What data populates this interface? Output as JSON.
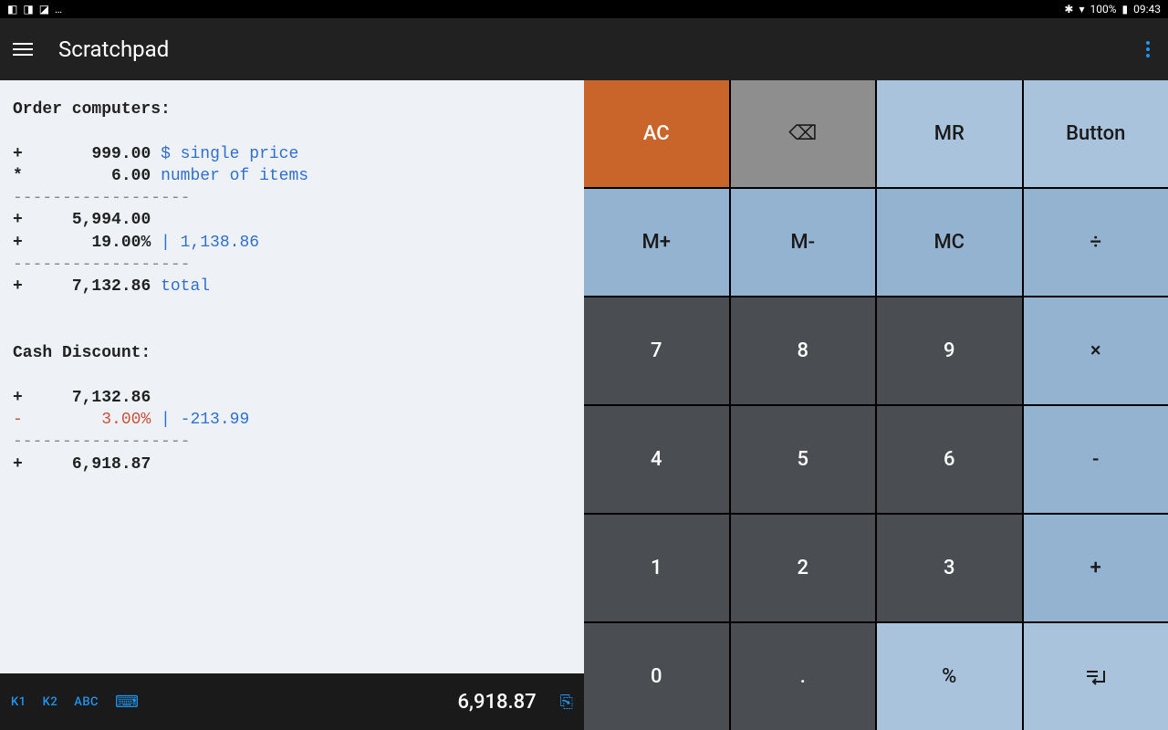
{
  "statusbar": {
    "battery": "100%",
    "time": "09:43"
  },
  "appbar": {
    "title": "Scratchpad"
  },
  "scratch": {
    "h1": "Order computers:",
    "l1_op": "+",
    "l1_val": "999.00",
    "l1_note": "$ single price",
    "l2_op": "*",
    "l2_val": "6.00",
    "l2_note": "number of items",
    "sep1": "------------------",
    "l3_op": "+",
    "l3_val": "5,994.00",
    "l4_op": "+",
    "l4_val": "19.00%",
    "l4_pipe": " | ",
    "l4_note": "1,138.86",
    "sep2": "------------------",
    "l5_op": "+",
    "l5_val": "7,132.86",
    "l5_note": "total",
    "h2": "Cash Discount:",
    "l6_op": "+",
    "l6_val": "7,132.86",
    "l7_op": "-",
    "l7_val": "3.00%",
    "l7_pipe": " | ",
    "l7_note": "-213.99",
    "sep3": "------------------",
    "l8_op": "+",
    "l8_val": "6,918.87"
  },
  "bottombar": {
    "tab1": "K1",
    "tab2": "K2",
    "tab3": "ABC",
    "result": "6,918.87"
  },
  "keypad": {
    "ac": "AC",
    "bs": "⌫",
    "mr": "MR",
    "btn": "Button",
    "mp": "M+",
    "mm": "M-",
    "mc": "MC",
    "div": "÷",
    "k7": "7",
    "k8": "8",
    "k9": "9",
    "mul": "×",
    "k4": "4",
    "k5": "5",
    "k6": "6",
    "sub": "-",
    "k1": "1",
    "k2": "2",
    "k3": "3",
    "add": "+",
    "k0": "0",
    "dot": ".",
    "pct": "%",
    "eq": "="
  }
}
